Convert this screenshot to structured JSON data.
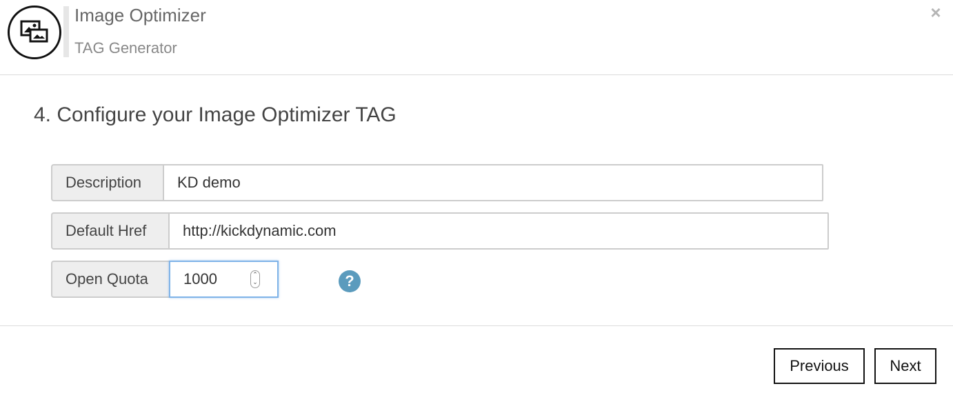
{
  "header": {
    "logo_icon": "image-optimizer-icon",
    "title": "Image Optimizer",
    "subtitle": "TAG Generator",
    "close_label": "×"
  },
  "step": {
    "title": "4. Configure your Image Optimizer TAG"
  },
  "form": {
    "description": {
      "label": "Description",
      "value": "KD demo"
    },
    "default_href": {
      "label": "Default Href",
      "value": "http://kickdynamic.com"
    },
    "open_quota": {
      "label": "Open Quota",
      "value": "1000",
      "spinner_up": "⌃",
      "spinner_down": "⌄"
    },
    "help_label": "?"
  },
  "footer": {
    "previous_label": "Previous",
    "next_label": "Next"
  },
  "colors": {
    "help_icon": "#5b9bbd",
    "focus_border": "#7fb3e8"
  }
}
